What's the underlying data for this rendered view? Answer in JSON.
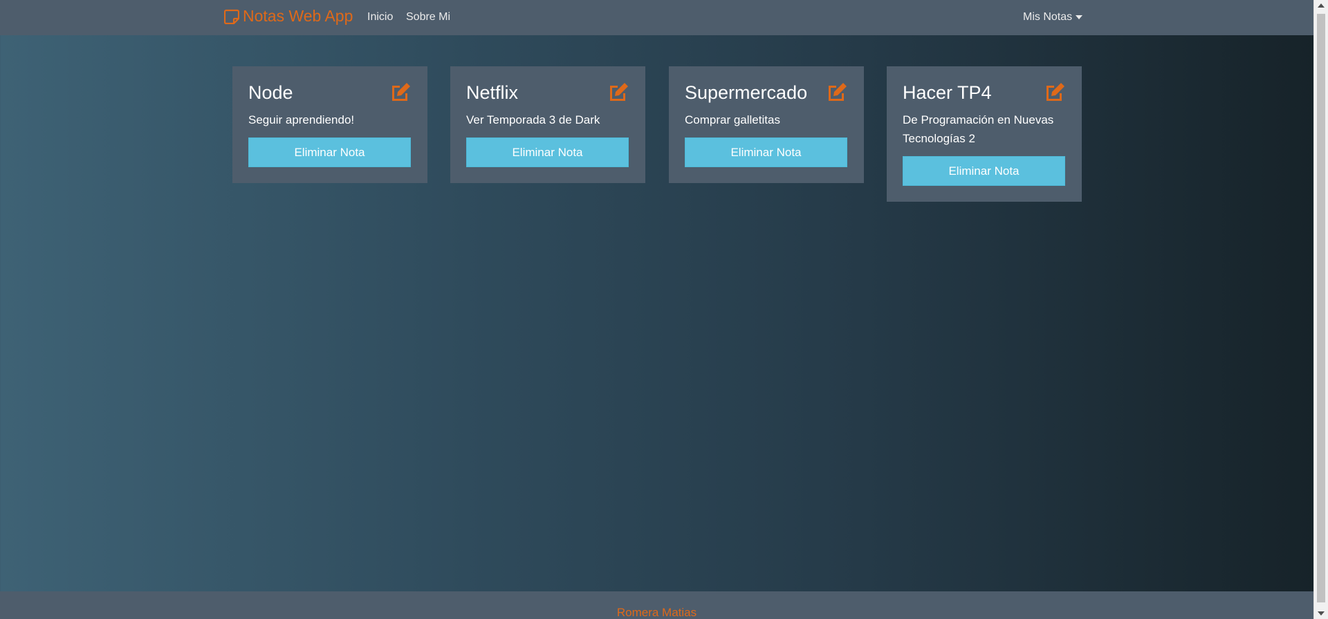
{
  "navbar": {
    "brand": "Notas Web App",
    "links": [
      {
        "label": "Inicio"
      },
      {
        "label": "Sobre Mi"
      }
    ],
    "dropdown_label": "Mis Notas"
  },
  "notes": [
    {
      "title": "Node",
      "text": "Seguir aprendiendo!",
      "delete_label": "Eliminar Nota"
    },
    {
      "title": "Netflix",
      "text": "Ver Temporada 3 de Dark",
      "delete_label": "Eliminar Nota"
    },
    {
      "title": "Supermercado",
      "text": "Comprar galletitas",
      "delete_label": "Eliminar Nota"
    },
    {
      "title": "Hacer TP4",
      "text": "De Programación en Nuevas Tecnologías 2",
      "delete_label": "Eliminar Nota"
    }
  ],
  "footer": {
    "text": "Romera Matias"
  },
  "colors": {
    "accent": "#df6919",
    "card_bg": "#4e5d6c",
    "button_bg": "#5bc0de"
  },
  "icons": {
    "brand": "sticky-note-icon",
    "edit": "edit-icon"
  }
}
